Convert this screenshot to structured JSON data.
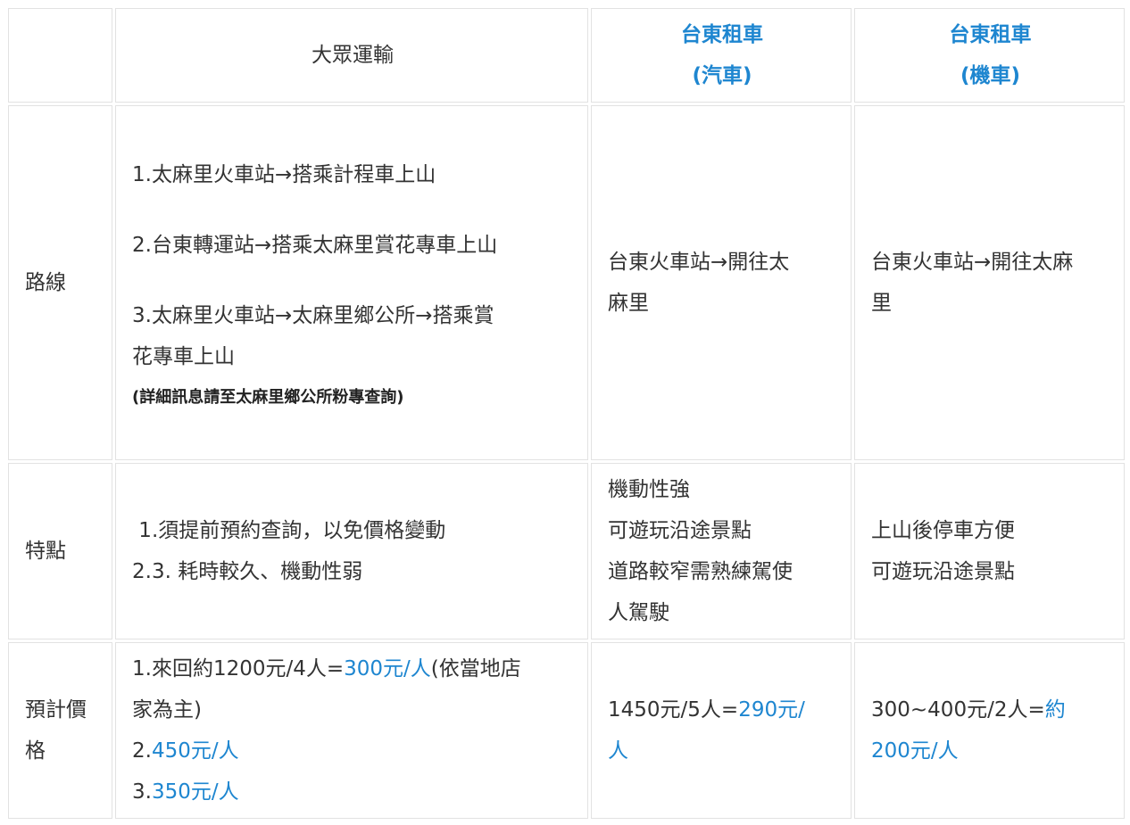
{
  "header": {
    "public": "大眾運輸",
    "car_title": "台東租車",
    "car_sub": "(汽車)",
    "moto_title": "台東租車",
    "moto_sub": "(機車)"
  },
  "route": {
    "label": "路線",
    "public_1": "1.太麻里火車站→搭乘計程車上山",
    "public_2": "2.台東轉運站→搭乘太麻里賞花專車上山",
    "public_3a": "3.太麻里火車站→太麻里鄉公所→搭乘賞",
    "public_3b": "花專車上山",
    "public_note": "(詳細訊息請至太麻里鄉公所粉專查詢)",
    "car_a": "台東火車站→開往太",
    "car_b": "麻里",
    "moto_a": "台東火車站→開往太麻",
    "moto_b": "里"
  },
  "feature": {
    "label": "特點",
    "public_1": " 1.須提前預約查詢，以免價格變動",
    "public_2": "2.3. 耗時較久、機動性弱",
    "car_1": "機動性強",
    "car_2": "可遊玩沿途景點",
    "car_3a": "道路較窄需熟練駕使",
    "car_3b": "人駕駛",
    "moto_1": "上山後停車方便",
    "moto_2": "可遊玩沿途景點"
  },
  "price": {
    "label_a": "預計價",
    "label_b": "格",
    "public_1a": "1.來回約1200元/4人=",
    "public_1_hl": "300元/人",
    "public_1b": "(依當地店",
    "public_1c": "家為主)",
    "public_2a": "2.",
    "public_2_hl": "450元/人",
    "public_3a": "3.",
    "public_3_hl": "350元/人",
    "car_a": "1450元/5人=",
    "car_hl_a": "290元/",
    "car_hl_b": "人",
    "moto_a": "300~400元/2人=",
    "moto_hl_a": "約",
    "moto_hl_b": "200元/人"
  },
  "colors": {
    "accent": "#1e86d0",
    "border": "#e2e2e2",
    "text": "#333333"
  }
}
